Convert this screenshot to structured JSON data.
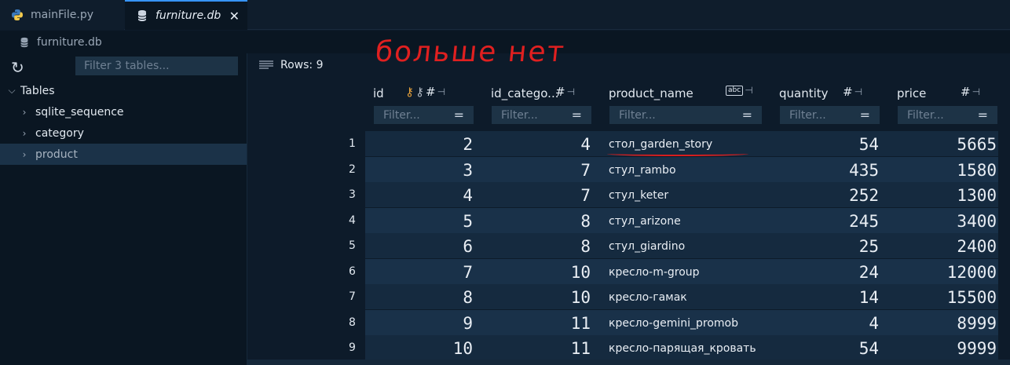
{
  "tabs": [
    {
      "label": "mainFile.py",
      "icon": "python-icon"
    },
    {
      "label": "furniture.db",
      "icon": "database-icon"
    }
  ],
  "breadcrumb": {
    "label": "furniture.db"
  },
  "sidebar": {
    "filter_placeholder": "Filter 3 tables...",
    "tables_label": "Tables",
    "items": [
      {
        "label": "sqlite_sequence"
      },
      {
        "label": "category"
      },
      {
        "label": "product"
      }
    ]
  },
  "main": {
    "rows_label": "Rows: 9",
    "annotation": "больше нет",
    "filter_placeholder": "Filter...",
    "columns": [
      {
        "name": "id"
      },
      {
        "name": "id_catego..."
      },
      {
        "name": "product_name"
      },
      {
        "name": "quantity"
      },
      {
        "name": "price"
      }
    ],
    "rows": [
      {
        "n": "1",
        "id": "2",
        "cat": "4",
        "name": "стол_garden_story",
        "qty": "54",
        "price": "5665"
      },
      {
        "n": "2",
        "id": "3",
        "cat": "7",
        "name": "стул_rambo",
        "qty": "435",
        "price": "1580"
      },
      {
        "n": "3",
        "id": "4",
        "cat": "7",
        "name": "стул_keter",
        "qty": "252",
        "price": "1300"
      },
      {
        "n": "4",
        "id": "5",
        "cat": "8",
        "name": "стул_arizone",
        "qty": "245",
        "price": "3400"
      },
      {
        "n": "5",
        "id": "6",
        "cat": "8",
        "name": "стул_giardino",
        "qty": "25",
        "price": "2400"
      },
      {
        "n": "6",
        "id": "7",
        "cat": "10",
        "name": "кресло-m-group",
        "qty": "24",
        "price": "12000"
      },
      {
        "n": "7",
        "id": "8",
        "cat": "10",
        "name": "кресло-гамак",
        "qty": "14",
        "price": "15500"
      },
      {
        "n": "8",
        "id": "9",
        "cat": "11",
        "name": "кресло-gemini_promob",
        "qty": "4",
        "price": "8999"
      },
      {
        "n": "9",
        "id": "10",
        "cat": "11",
        "name": "кресло-парящая_кровать",
        "qty": "54",
        "price": "9999"
      }
    ]
  },
  "colors": {
    "accent": "#3794ff",
    "annotation": "#e02020",
    "key_icon": "#e8a23a"
  }
}
